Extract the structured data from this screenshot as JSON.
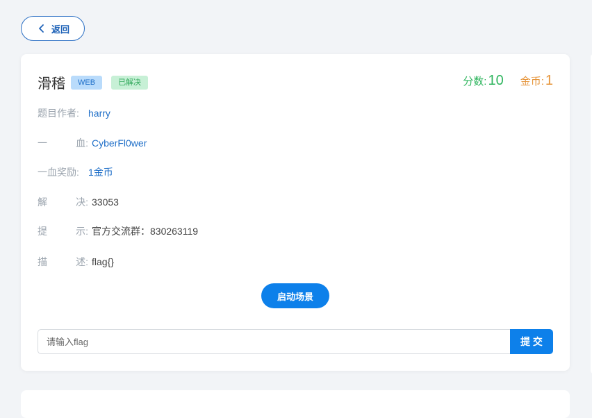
{
  "back_button": {
    "label": "返回",
    "icon": "chevron-left-icon"
  },
  "challenge": {
    "title": "滑稽",
    "category_badge": "WEB",
    "status_badge": "已解决",
    "score_label": "分数:",
    "score_value": "10",
    "coin_label": "金币:",
    "coin_value": "1"
  },
  "info": {
    "author_label": "题目作者:",
    "author_value": "harry",
    "first_blood_label": [
      "一",
      "血:"
    ],
    "first_blood_value": "CyberFl0wer",
    "first_blood_reward_label": "一血奖励:",
    "first_blood_reward_value": "1金币",
    "solves_label": [
      "解",
      "决:"
    ],
    "solves_value": "33053",
    "hint_label": [
      "提",
      "示:"
    ],
    "hint_value": "官方交流群：830263119",
    "description_label": [
      "描",
      "述:"
    ],
    "description_value": "flag{}"
  },
  "launch_button": "启动场景",
  "flag_form": {
    "placeholder": "请输入flag",
    "value": "",
    "submit_label": "提 交"
  },
  "colors": {
    "accent": "#0d80ea",
    "score": "#2fb55e",
    "coin": "#e6953b",
    "link": "#1f6fc8",
    "background": "#f2f4f7"
  }
}
